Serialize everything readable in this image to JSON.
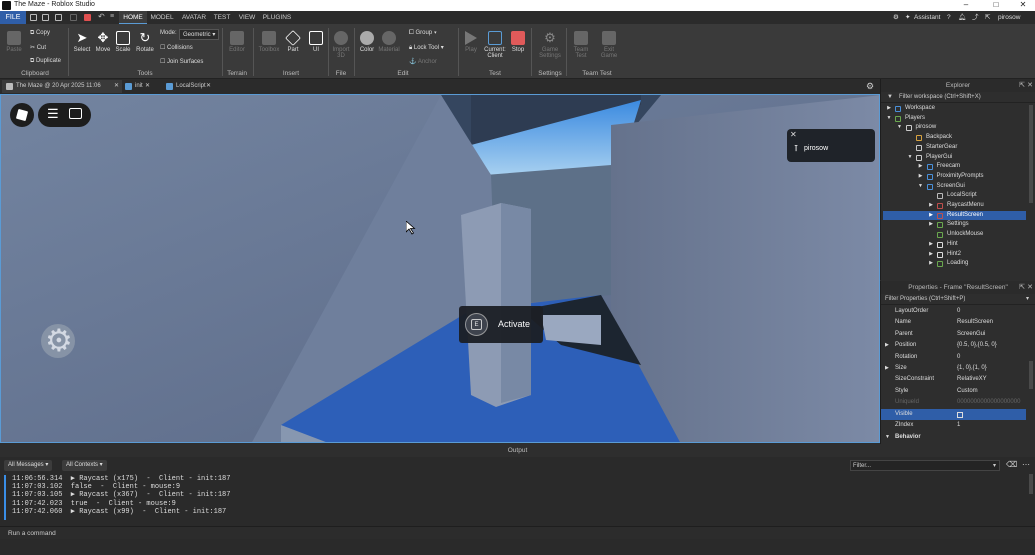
{
  "window": {
    "title": "The Maze - Roblox Studio",
    "min": "–",
    "max": "□",
    "close": "✕"
  },
  "menu": {
    "file": "FILE",
    "tabs": [
      "HOME",
      "MODEL",
      "AVATAR",
      "TEST",
      "VIEW",
      "PLUGINS"
    ],
    "assistant": "Assistant",
    "user": "pirosow"
  },
  "ribbon": {
    "clipboard": {
      "paste": "Paste",
      "copy": "Copy",
      "cut": "Cut",
      "duplicate": "Duplicate",
      "group": "Clipboard"
    },
    "tools": {
      "select": "Select",
      "move": "Move",
      "scale": "Scale",
      "rotate": "Rotate",
      "mode_label": "Mode:",
      "mode_value": "Geometric",
      "collisions": "Collisions",
      "join_surfaces": "Join Surfaces",
      "group": "Tools"
    },
    "terrain": {
      "editor": "Editor",
      "group": "Terrain"
    },
    "insert": {
      "toolbox": "Toolbox",
      "part": "Part",
      "ui": "UI",
      "group": "Insert"
    },
    "file": {
      "import3d": "Import 3D",
      "group": "File"
    },
    "edit": {
      "material": "Material",
      "color": "Color",
      "group_btn": "Group",
      "lock_tool": "Lock Tool",
      "anchor": "Anchor",
      "group": "Edit"
    },
    "test": {
      "play": "Play",
      "current_client": "Current: Client",
      "stop": "Stop",
      "group": "Test"
    },
    "settings": {
      "game_settings": "Game Settings",
      "group": "Settings"
    },
    "team_test": {
      "team_test": "Team Test",
      "exit_game": "Exit Game",
      "group": "Team Test"
    }
  },
  "doc_tabs": [
    {
      "label": "The Maze @ 20 Apr 2025 11:06"
    },
    {
      "label": "init"
    },
    {
      "label": "LocalScript"
    }
  ],
  "viewport": {
    "notification_user": "pirosow",
    "prompt_key": "E",
    "prompt_action": "Activate"
  },
  "explorer": {
    "title": "Explorer",
    "filter": "Filter workspace (Ctrl+Shift+X)",
    "items": [
      {
        "label": "Workspace",
        "arrow": "▶",
        "indent": 0,
        "color": "#4a90d9"
      },
      {
        "label": "Players",
        "arrow": "▼",
        "indent": 0,
        "color": "#6aa84f"
      },
      {
        "label": "pirosow",
        "arrow": "▼",
        "indent": 1,
        "color": "#cccccc"
      },
      {
        "label": "Backpack",
        "arrow": "",
        "indent": 2,
        "color": "#d9a441"
      },
      {
        "label": "StarterGear",
        "arrow": "",
        "indent": 2,
        "color": "#cccccc"
      },
      {
        "label": "PlayerGui",
        "arrow": "▼",
        "indent": 2,
        "color": "#cccccc"
      },
      {
        "label": "Freecam",
        "arrow": "▶",
        "indent": 3,
        "color": "#4a90d9"
      },
      {
        "label": "ProximityPrompts",
        "arrow": "▶",
        "indent": 3,
        "color": "#4a90d9"
      },
      {
        "label": "ScreenGui",
        "arrow": "▼",
        "indent": 3,
        "color": "#4a90d9"
      },
      {
        "label": "LocalScript",
        "arrow": "",
        "indent": 4,
        "color": "#bbbbbb"
      },
      {
        "label": "RaycastMenu",
        "arrow": "▶",
        "indent": 4,
        "color": "#c0504d"
      },
      {
        "label": "ResultScreen",
        "arrow": "▶",
        "indent": 4,
        "color": "#c0504d",
        "selected": true
      },
      {
        "label": "Settings",
        "arrow": "▶",
        "indent": 4,
        "color": "#6aa84f"
      },
      {
        "label": "UnlockMouse",
        "arrow": "",
        "indent": 4,
        "color": "#6aa84f"
      },
      {
        "label": "Hint",
        "arrow": "▶",
        "indent": 4,
        "color": "#dddddd"
      },
      {
        "label": "Hint2",
        "arrow": "▶",
        "indent": 4,
        "color": "#dddddd"
      },
      {
        "label": "Loading",
        "arrow": "▶",
        "indent": 4,
        "color": "#6aa84f"
      }
    ]
  },
  "properties": {
    "title": "Properties - Frame \"ResultScreen\"",
    "filter": "Filter Properties (Ctrl+Shift+P)",
    "rows": [
      {
        "k": "LayoutOrder",
        "v": "0"
      },
      {
        "k": "Name",
        "v": "ResultScreen"
      },
      {
        "k": "Parent",
        "v": "ScreenGui"
      },
      {
        "k": "Position",
        "v": "{0.5, 0},{0.5, 0}",
        "arrow": "▶"
      },
      {
        "k": "Rotation",
        "v": "0"
      },
      {
        "k": "Size",
        "v": "{1, 0},{1, 0}",
        "arrow": "▶"
      },
      {
        "k": "SizeConstraint",
        "v": "RelativeXY"
      },
      {
        "k": "Style",
        "v": "Custom"
      },
      {
        "k": "UniqueId",
        "v": "0000000000000000000",
        "disabled": true
      },
      {
        "k": "Visible",
        "v": "",
        "selected": true,
        "checkbox": true
      },
      {
        "k": "ZIndex",
        "v": "1"
      }
    ],
    "section": "Behavior"
  },
  "output": {
    "title": "Output",
    "all_messages": "All Messages",
    "all_contexts": "All Contexts",
    "filter": "Filter...",
    "lines": [
      "11:06:56.314  ▶ Raycast (x175)  -  Client - init:187",
      "11:07:03.102  false  -  Client - mouse:9",
      "11:07:03.105  ▶ Raycast (x367)  -  Client - init:187",
      "11:07:42.023  true  -  Client - mouse:9",
      "11:07:42.060  ▶ Raycast (x99)  -  Client - init:187"
    ],
    "command_placeholder": "Run a command"
  }
}
